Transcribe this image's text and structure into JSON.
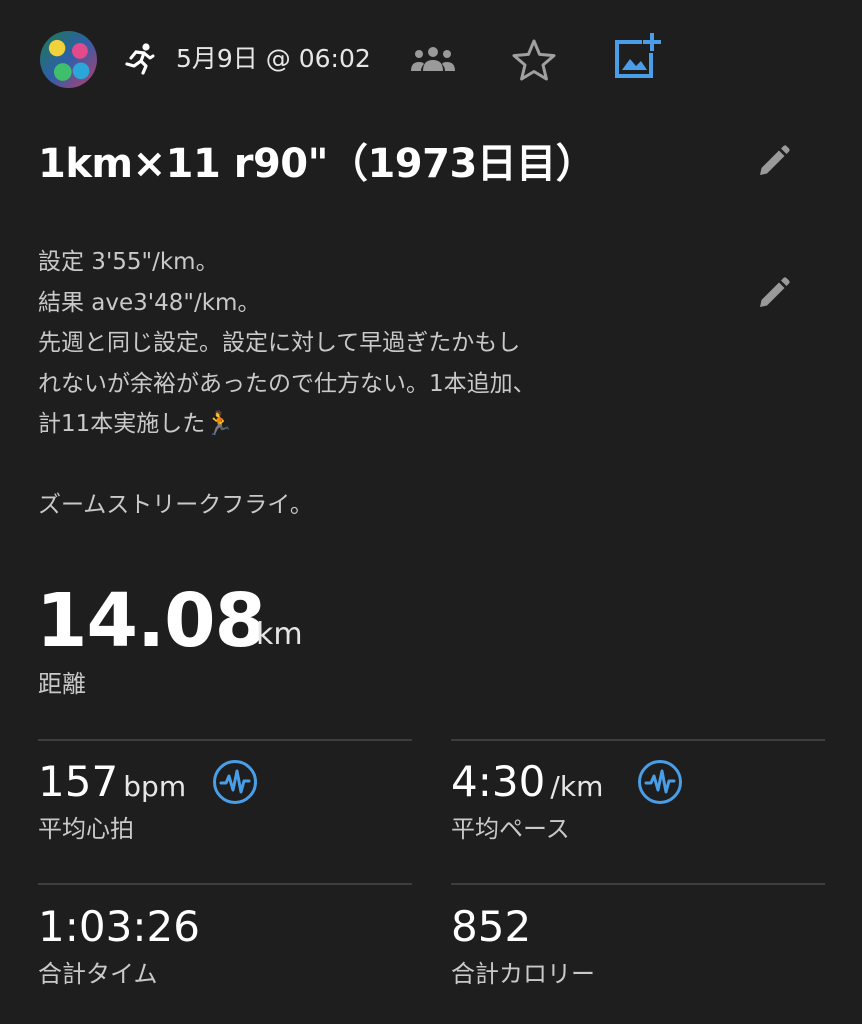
{
  "header": {
    "date": "5月9日 @ 06:02",
    "avatar": "avatar",
    "icons": [
      "running-icon",
      "group-icon",
      "star-icon",
      "add-photo-icon"
    ],
    "accent_color": "#4a9ee8"
  },
  "activity": {
    "title": "1km×11 r90\"（1973日目）",
    "description": "設定 3'55\"/km。\n結果 ave3'48\"/km。\n先週と同じ設定。設定に対して早過ぎたかもし\nれないが余裕があったので仕方ない。1本追加、\n計11本実施した🏃\n\nズームストリークフライ。"
  },
  "distance": {
    "value": "14.08",
    "unit": "km",
    "label": "距離"
  },
  "stats": {
    "avg_hr": {
      "value": "157",
      "unit": "bpm",
      "label": "平均心拍",
      "icon": "activity-wave-icon"
    },
    "avg_pace": {
      "value": "4:30",
      "unit": "/km",
      "label": "平均ペース",
      "icon": "activity-wave-icon"
    },
    "total_time": {
      "value": "1:03:26",
      "label": "合計タイム"
    },
    "calories": {
      "value": "852",
      "label": "合計カロリー"
    }
  }
}
